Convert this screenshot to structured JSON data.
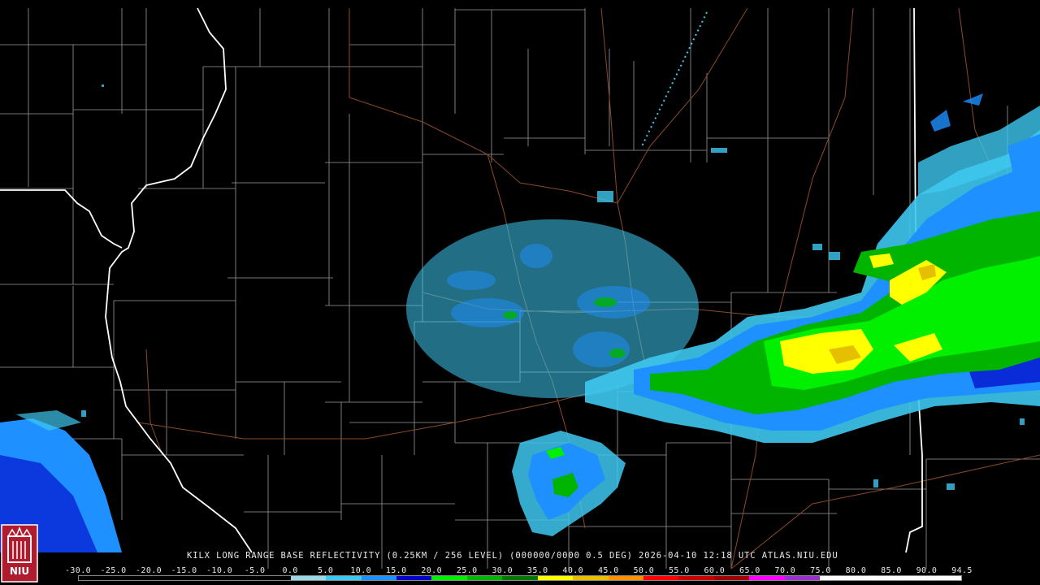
{
  "title_line": "KILX LONG RANGE BASE REFLECTIVITY (0.25KM / 256 LEVEL) (000000/0000 0.5 DEG) 2026-04-10 12:18 UTC  ATLAS.NIU.EDU",
  "logo_text": "NIU",
  "legend": {
    "labels": [
      "-30.0",
      "-25.0",
      "-20.0",
      "-15.0",
      "-10.0",
      "-5.0",
      "0.0",
      "5.0",
      "10.0",
      "15.0",
      "20.0",
      "25.0",
      "30.0",
      "35.0",
      "40.0",
      "45.0",
      "50.0",
      "55.0",
      "60.0",
      "65.0",
      "70.0",
      "75.0",
      "80.0",
      "85.0",
      "90.0",
      "94.5"
    ],
    "colors": [
      "#000000",
      "#000000",
      "#000000",
      "#000000",
      "#000000",
      "#000000",
      "#9ad7e8",
      "#3ec8f0",
      "#1e90ff",
      "#0000c8",
      "#00f000",
      "#00b400",
      "#007800",
      "#ffff00",
      "#e6c000",
      "#ff9000",
      "#ff0000",
      "#c80000",
      "#a00000",
      "#ff00ff",
      "#9932cc",
      "#ffffff",
      "#ffffff",
      "#ffffff",
      "#ffffff"
    ]
  },
  "colors": {
    "background": "#000000",
    "county_lines": "#9a9a9a",
    "state_lines": "#ffffff",
    "highways": "#8b4a2a"
  }
}
